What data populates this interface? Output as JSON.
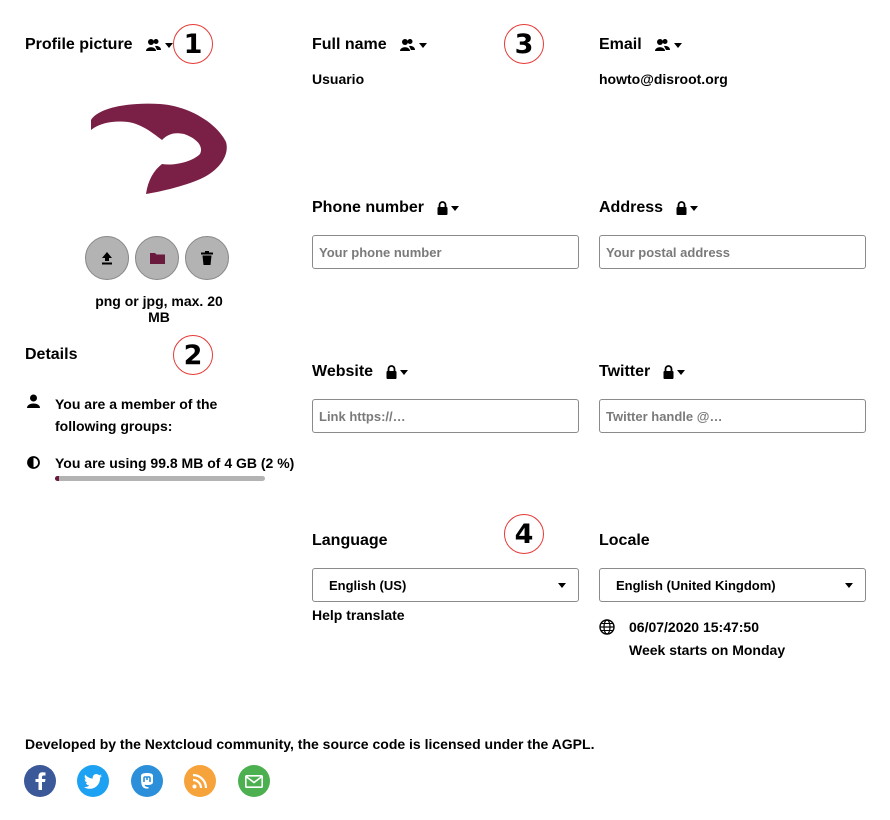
{
  "profile": {
    "heading": "Profile picture",
    "hint": "png or jpg, max. 20 MB",
    "buttons": [
      "upload-icon",
      "folder-icon",
      "trash-icon"
    ],
    "avatar_color": "#7a1f45"
  },
  "fullname": {
    "label": "Full name",
    "value": "Usuario"
  },
  "email": {
    "label": "Email",
    "value": "howto@disroot.org"
  },
  "phone": {
    "label": "Phone number",
    "placeholder": "Your phone number"
  },
  "address": {
    "label": "Address",
    "placeholder": "Your postal address"
  },
  "website": {
    "label": "Website",
    "placeholder": "Link https://…"
  },
  "twitter": {
    "label": "Twitter",
    "placeholder": "Twitter handle @…"
  },
  "details": {
    "heading": "Details",
    "groups_text": "You are a member of the following groups:",
    "quota_text": "You are using 99.8 MB of 4 GB (2 %)",
    "quota_fraction": 0.02
  },
  "language": {
    "label": "Language",
    "selected": "English (US)",
    "help": "Help translate"
  },
  "locale": {
    "label": "Locale",
    "selected": "English (United Kingdom)",
    "time": "06/07/2020 15:47:50",
    "week": "Week starts on Monday"
  },
  "annotations": [
    "1",
    "2",
    "3",
    "4"
  ],
  "footer": {
    "text": "Developed by the Nextcloud community, the source code is licensed under the AGPL.",
    "icons": [
      "facebook-icon",
      "twitter-icon",
      "mastodon-icon",
      "rss-icon",
      "mail-icon"
    ]
  },
  "colors": {
    "annotation_red": "#e53935",
    "facebook": "#3b5998",
    "twitter": "#1da1f2",
    "mastodon": "#2b90d9",
    "rss": "#f7a33b",
    "mail": "#4caf50"
  }
}
